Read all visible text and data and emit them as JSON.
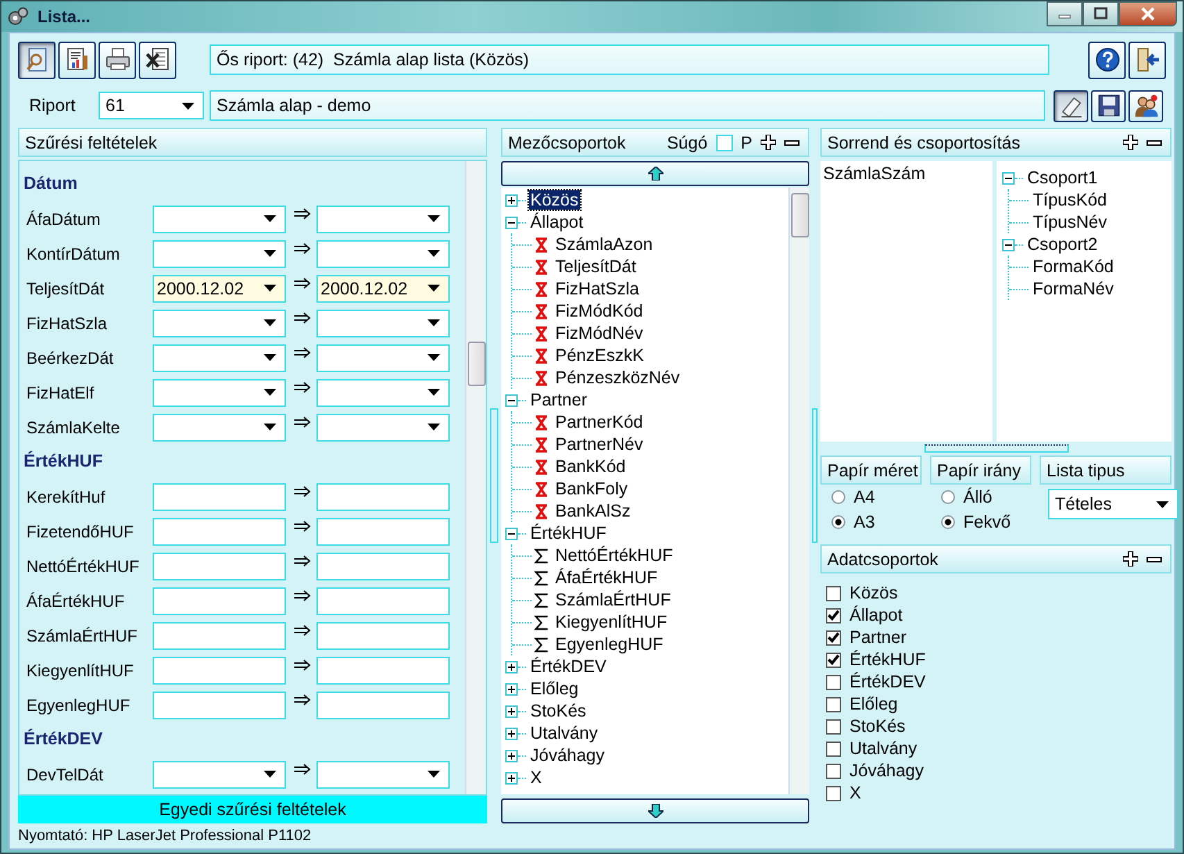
{
  "window": {
    "title": "Lista..."
  },
  "toolbar": {
    "parent_report": "Ős riport: (42)  Számla alap lista (Közös)"
  },
  "report": {
    "label": "Riport",
    "number": "61",
    "name": "Számla alap - demo"
  },
  "filters": {
    "title": "Szűrési feltételek",
    "footer_button": "Egyedi szűrési feltételek",
    "groups": [
      {
        "title": "Dátum",
        "rows": [
          {
            "label": "ÁfaDátum",
            "kind": "date"
          },
          {
            "label": "KontírDátum",
            "kind": "date"
          },
          {
            "label": "TeljesítDát",
            "kind": "date",
            "from": "2000.12.02",
            "to": "2000.12.02"
          },
          {
            "label": "FizHatSzla",
            "kind": "date"
          },
          {
            "label": "BeérkezDát",
            "kind": "date"
          },
          {
            "label": "FizHatElf",
            "kind": "date"
          },
          {
            "label": "SzámlaKelte",
            "kind": "date"
          }
        ]
      },
      {
        "title": "ÉrtékHUF",
        "rows": [
          {
            "label": "KerekítHuf",
            "kind": "number"
          },
          {
            "label": "FizetendőHUF",
            "kind": "number"
          },
          {
            "label": "NettóÉrtékHUF",
            "kind": "number"
          },
          {
            "label": "ÁfaÉrtékHUF",
            "kind": "number"
          },
          {
            "label": "SzámlaÉrtHUF",
            "kind": "number"
          },
          {
            "label": "KiegyenlítHUF",
            "kind": "number"
          },
          {
            "label": "EgyenlegHUF",
            "kind": "number"
          }
        ]
      },
      {
        "title": "ÉrtékDEV",
        "rows": [
          {
            "label": "DevTelDát",
            "kind": "date"
          }
        ]
      }
    ]
  },
  "field_groups": {
    "title": "Mezőcsoportok",
    "help_label": "Súgó",
    "help_checked": false,
    "p_label": "P",
    "tree": [
      {
        "label": "Közös",
        "expanded": false,
        "selected": true
      },
      {
        "label": "Állapot",
        "expanded": true,
        "selected": false,
        "children": [
          {
            "label": "SzámlaAzon",
            "kind": "dimension"
          },
          {
            "label": "TeljesítDát",
            "kind": "dimension"
          },
          {
            "label": "FizHatSzla",
            "kind": "dimension"
          },
          {
            "label": "FizMódKód",
            "kind": "dimension"
          },
          {
            "label": "FizMódNév",
            "kind": "dimension"
          },
          {
            "label": "PénzEszkK",
            "kind": "dimension"
          },
          {
            "label": "PénzeszközNév",
            "kind": "dimension"
          }
        ]
      },
      {
        "label": "Partner",
        "expanded": true,
        "selected": false,
        "children": [
          {
            "label": "PartnerKód",
            "kind": "dimension"
          },
          {
            "label": "PartnerNév",
            "kind": "dimension"
          },
          {
            "label": "BankKód",
            "kind": "dimension"
          },
          {
            "label": "BankFoly",
            "kind": "dimension"
          },
          {
            "label": "BankAlSz",
            "kind": "dimension"
          }
        ]
      },
      {
        "label": "ÉrtékHUF",
        "expanded": true,
        "selected": false,
        "children": [
          {
            "label": "NettóÉrtékHUF",
            "kind": "measure"
          },
          {
            "label": "ÁfaÉrtékHUF",
            "kind": "measure"
          },
          {
            "label": "SzámlaÉrtHUF",
            "kind": "measure"
          },
          {
            "label": "KiegyenlítHUF",
            "kind": "measure"
          },
          {
            "label": "EgyenlegHUF",
            "kind": "measure"
          }
        ]
      },
      {
        "label": "ÉrtékDEV",
        "expanded": false,
        "selected": false
      },
      {
        "label": "Előleg",
        "expanded": false,
        "selected": false
      },
      {
        "label": "StoKés",
        "expanded": false,
        "selected": false
      },
      {
        "label": "Utalvány",
        "expanded": false,
        "selected": false
      },
      {
        "label": "Jóváhagy",
        "expanded": false,
        "selected": false
      },
      {
        "label": "X",
        "expanded": false,
        "selected": false
      }
    ]
  },
  "sorting": {
    "title": "Sorrend és csoportosítás",
    "sort_fields": [
      "SzámlaSzám"
    ],
    "groups": [
      {
        "label": "Csoport1",
        "expanded": true,
        "children": [
          {
            "label": "TípusKód"
          },
          {
            "label": "TípusNév"
          }
        ]
      },
      {
        "label": "Csoport2",
        "expanded": true,
        "children": [
          {
            "label": "FormaKód"
          },
          {
            "label": "FormaNév"
          }
        ]
      }
    ]
  },
  "paper_size": {
    "title": "Papír méret",
    "options": [
      {
        "label": "A4",
        "selected": false
      },
      {
        "label": "A3",
        "selected": true
      }
    ]
  },
  "orientation": {
    "title": "Papír irány",
    "options": [
      {
        "label": "Álló",
        "selected": false
      },
      {
        "label": "Fekvő",
        "selected": true
      }
    ]
  },
  "list_type": {
    "title": "Lista tipus",
    "value": "Tételes"
  },
  "data_groups": {
    "title": "Adatcsoportok",
    "items": [
      {
        "label": "Közös",
        "checked": false
      },
      {
        "label": "Állapot",
        "checked": true
      },
      {
        "label": "Partner",
        "checked": true
      },
      {
        "label": "ÉrtékHUF",
        "checked": true
      },
      {
        "label": "ÉrtékDEV",
        "checked": false
      },
      {
        "label": "Előleg",
        "checked": false
      },
      {
        "label": "StoKés",
        "checked": false
      },
      {
        "label": "Utalvány",
        "checked": false
      },
      {
        "label": "Jóváhagy",
        "checked": false
      },
      {
        "label": "X",
        "checked": false
      }
    ]
  },
  "status_bar": {
    "printer": "Nyomtató: HP LaserJet Professional P1102"
  }
}
